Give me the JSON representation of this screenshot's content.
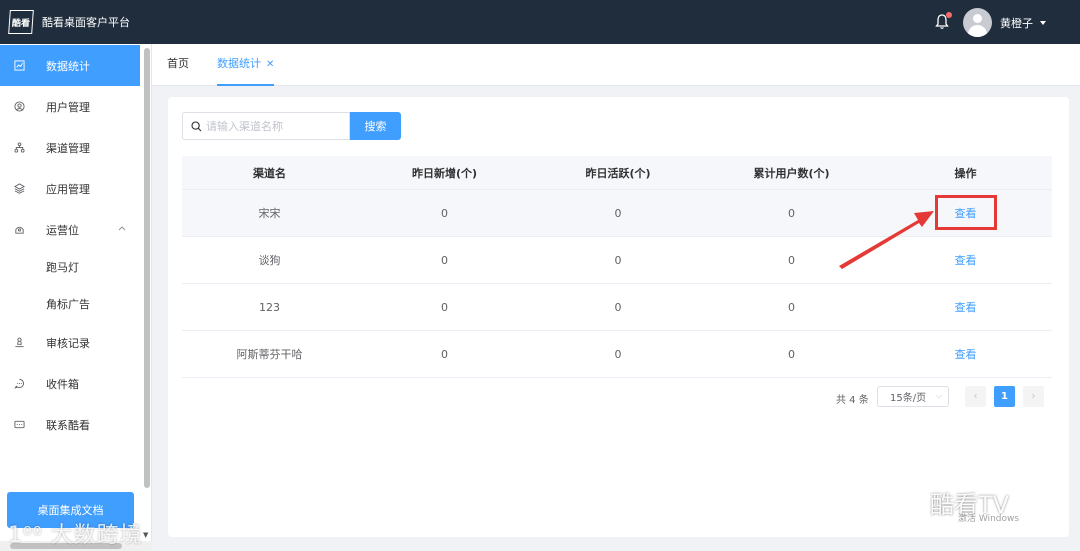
{
  "header": {
    "logo_text": "酷看",
    "app_title": "酷看桌面客户平台",
    "username": "黄橙子",
    "notification_icon": "bell-icon"
  },
  "sidebar": {
    "items": [
      {
        "label": "数据统计",
        "icon": "chart-icon",
        "active": true
      },
      {
        "label": "用户管理",
        "icon": "user-icon"
      },
      {
        "label": "渠道管理",
        "icon": "channel-icon"
      },
      {
        "label": "应用管理",
        "icon": "layers-icon"
      },
      {
        "label": "运营位",
        "icon": "operations-icon",
        "expanded": true
      },
      {
        "label": "跑马灯",
        "sub": true
      },
      {
        "label": "角标广告",
        "sub": true
      },
      {
        "label": "审核记录",
        "icon": "review-icon"
      },
      {
        "label": "收件箱",
        "icon": "inbox-icon"
      },
      {
        "label": "联系酷看",
        "icon": "contact-icon"
      }
    ],
    "doc_button": "桌面集成文档"
  },
  "tabs": [
    {
      "label": "首页"
    },
    {
      "label": "数据统计",
      "active": true,
      "closable": true
    }
  ],
  "search": {
    "placeholder": "请输入渠道名称",
    "button_label": "搜索"
  },
  "table": {
    "columns": [
      "渠道名",
      "昨日新增(个)",
      "昨日活跃(个)",
      "累计用户数(个)",
      "操作"
    ],
    "rows": [
      [
        "宋宋",
        "0",
        "0",
        "0",
        "查看"
      ],
      [
        "谈狗",
        "0",
        "0",
        "0",
        "查看"
      ],
      [
        "123",
        "0",
        "0",
        "0",
        "查看"
      ],
      [
        "阿斯蒂芬干哈",
        "0",
        "0",
        "0",
        "查看"
      ]
    ]
  },
  "pagination": {
    "total": "共 4 条",
    "page_size": "15条/页",
    "current_page": "1"
  },
  "watermarks": {
    "left": "大数跨境",
    "right": "酷看TV",
    "windows": "激活 Windows"
  },
  "colors": {
    "header_bg": "#1f2d3d",
    "primary": "#409eff",
    "annotation": "#e53935"
  }
}
